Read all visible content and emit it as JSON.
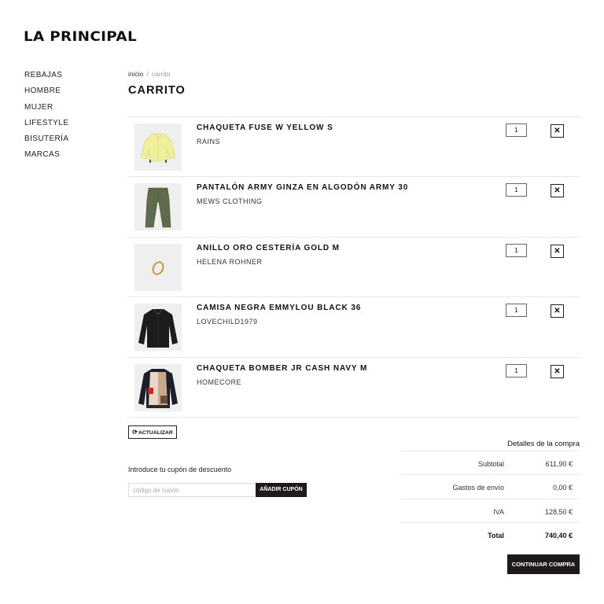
{
  "brand": {
    "logo_text": "LA PRINCIPAL"
  },
  "nav": {
    "items": [
      {
        "label": "REBAJAS"
      },
      {
        "label": "HOMBRE"
      },
      {
        "label": "MUJER"
      },
      {
        "label": "LIFESTYLE"
      },
      {
        "label": "BISUTERÍA"
      },
      {
        "label": "MARCAS"
      }
    ]
  },
  "breadcrumb": {
    "home": "inicio",
    "separator": "/",
    "current": "carrito"
  },
  "page": {
    "title": "CARRITO"
  },
  "cart": {
    "items": [
      {
        "name": "CHAQUETA FUSE W YELLOW S",
        "brand": "RAINS",
        "qty": "1",
        "remove": "✕",
        "image": "yellow-jacket"
      },
      {
        "name": "PANTALÓN ARMY GINZA EN ALGODÓN ARMY 30",
        "brand": "MEWS CLOTHING",
        "qty": "1",
        "remove": "✕",
        "image": "army-pants"
      },
      {
        "name": "ANILLO ORO CESTERÍA GOLD M",
        "brand": "HELENA ROHNER",
        "qty": "1",
        "remove": "✕",
        "image": "gold-ring"
      },
      {
        "name": "CAMISA NEGRA EMMYLOU BLACK 36",
        "brand": "LOVECHILD1979",
        "qty": "1",
        "remove": "✕",
        "image": "black-shirt"
      },
      {
        "name": "CHAQUETA BOMBER JR CASH NAVY M",
        "brand": "HOMECORE",
        "qty": "1",
        "remove": "✕",
        "image": "bomber-jacket"
      }
    ],
    "update_label": "ACTUALIZAR",
    "update_icon": "refresh-icon"
  },
  "coupon": {
    "label": "Introduce tu cupón de descuento",
    "placeholder": "código de cupón",
    "button_label": "AÑADIR CUPÓN"
  },
  "summary": {
    "title": "Detalles de la compra",
    "subtotal_label": "Subtotal",
    "subtotal_value": "611,90 €",
    "shipping_label": "Gastos de envío",
    "shipping_value": "0,00 €",
    "tax_label": "IVA",
    "tax_value": "128,50 €",
    "total_label": "Total",
    "total_value": "740,40 €"
  },
  "checkout": {
    "button_label": "CONTINUAR COMPRA"
  },
  "colors": {
    "button_dark": "#1e1a1a",
    "divider": "#e7e7e7",
    "thumb_bg": "#eeeeee"
  }
}
